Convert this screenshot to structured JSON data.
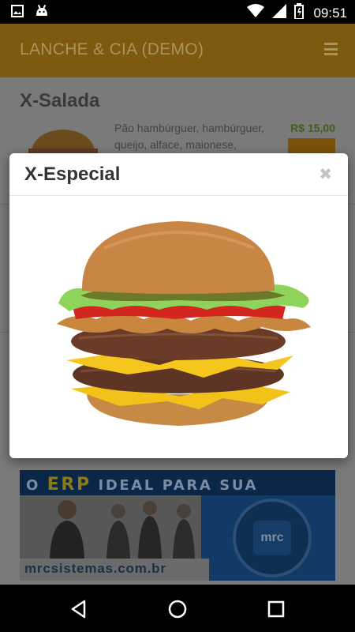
{
  "status_bar": {
    "time": "09:51",
    "icons": [
      "image-icon",
      "android-icon",
      "wifi-icon",
      "signal-icon",
      "battery-icon"
    ]
  },
  "app_bar": {
    "title": "LANCHE & CIA (DEMO)",
    "menu_icon": "hamburger-menu-icon"
  },
  "product": {
    "name": "X-Salada",
    "description": "Pão hambúrguer, hambúrguer, queijo, alface, maionese,",
    "price": "R$ 15,00"
  },
  "banner": {
    "headline_prefix": "O ",
    "headline_highlight": "ERP",
    "headline_suffix": " IDEAL PARA SUA EMPRESA",
    "url": "mrcsistemas.com.br",
    "logo_text": "mrc"
  },
  "modal": {
    "title": "X-Especial",
    "close_symbol": "✖"
  },
  "colors": {
    "app_bar_dimmed": "#7e5a10",
    "overlay_background": "#7a7a7a",
    "modal_background": "#ffffff"
  }
}
